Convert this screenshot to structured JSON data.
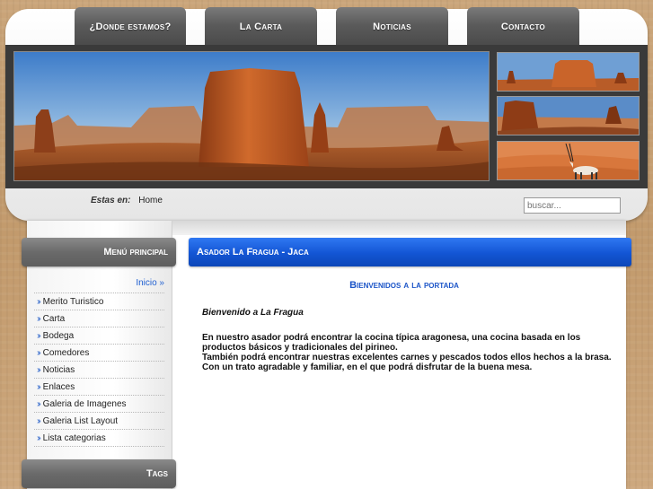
{
  "nav": {
    "items": [
      {
        "label": "¿Donde estamos?"
      },
      {
        "label": "La Carta"
      },
      {
        "label": "Noticias"
      },
      {
        "label": "Contacto"
      }
    ]
  },
  "breadcrumb": {
    "label": "Estas en:",
    "current": "Home"
  },
  "search": {
    "placeholder": "buscar..."
  },
  "sidebar": {
    "menu_title": "Menú principal",
    "home_link": "Inicio »",
    "items": [
      {
        "label": "Merito Turistico"
      },
      {
        "label": "Carta"
      },
      {
        "label": "Bodega"
      },
      {
        "label": "Comedores"
      },
      {
        "label": "Noticias"
      },
      {
        "label": "Enlaces"
      },
      {
        "label": "Galeria de Imagenes"
      },
      {
        "label": "Galeria List Layout"
      },
      {
        "label": "Lista categorias"
      }
    ],
    "tags_title": "Tags"
  },
  "main": {
    "header_title": "Asador La Fragua - Jaca",
    "welcome_title": "Bienvenidos a la portada",
    "intro": "Bienvenido a La Fragua",
    "paragraphs": [
      "En nuestro asador podrá encontrar la cocina típica aragonesa, una cocina basada en los productos básicos y tradicionales del pirineo.",
      "También podrá encontrar nuestras excelentes carnes y pescados todos ellos hechos a la brasa.",
      "Con un trato agradable y familiar, en el que podrá disfrutar de la buena mesa."
    ]
  },
  "colors": {
    "accent_blue": "#1355d4",
    "link_blue": "#1f5fd1",
    "tab_gray": "#5b5b5b",
    "desert_tan": "#c9a274"
  },
  "icons": {
    "menu_bullet": "double-chevron-right-icon"
  }
}
